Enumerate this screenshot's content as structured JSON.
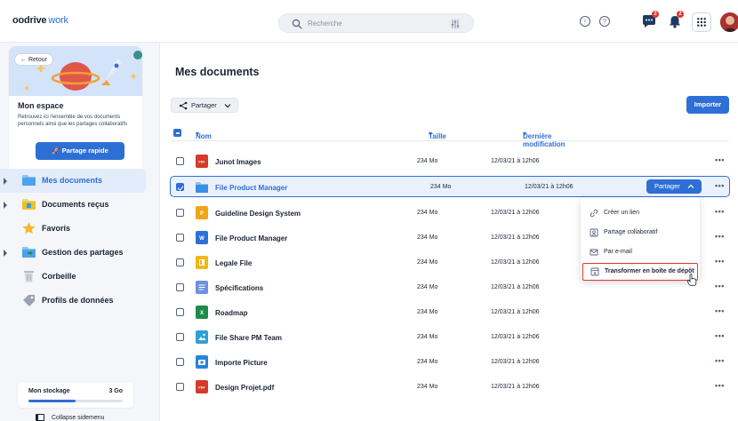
{
  "brand": {
    "name": "oodrive",
    "product": "work"
  },
  "search": {
    "placeholder": "Recherche"
  },
  "topbar": {
    "chat_badge": "2",
    "notif_badge": "2"
  },
  "sidebar": {
    "back_label": "Retour",
    "space_title": "Mon espace",
    "space_desc": "Retrouvez ici l'ensemble de vos documents personnels ainsi que les partages collaboratifs",
    "quick_share_label": "Partage rapide",
    "items": [
      {
        "label": "Mes documents",
        "icon": "folder-icon",
        "active": true
      },
      {
        "label": "Documents reçus",
        "icon": "received-folder-icon"
      },
      {
        "label": "Favoris",
        "icon": "star-icon"
      },
      {
        "label": "Gestion des partages",
        "icon": "share-folder-icon"
      },
      {
        "label": "Corbeille",
        "icon": "trash-icon"
      },
      {
        "label": "Profils de données",
        "icon": "tag-icon"
      }
    ],
    "storage_label": "Mon stockage",
    "storage_value": "3 Go",
    "storage_used_fraction": 0.5,
    "collapse_label": "Collapse sidemenu"
  },
  "main": {
    "title": "Mes documents",
    "share_button": "Partager",
    "import_button": "Importer",
    "columns": {
      "name": "Nom",
      "size": "Taille",
      "modified": "Dernière modification"
    },
    "rows": [
      {
        "name": "Junot Images",
        "size": "234 Mo",
        "date": "12/03/21 à 12h06",
        "icon": "pdf-icon",
        "color": "#d63a2a",
        "badge": "PDF"
      },
      {
        "name": "File Product Manager",
        "size": "234 Mo",
        "date": "12/03/21 à 12h06",
        "icon": "folder-icon",
        "color": "#3a8ee6",
        "selected": true
      },
      {
        "name": "Guideline Design System",
        "size": "234 Mo",
        "date": "12/03/21 à 12h06",
        "icon": "slides-icon",
        "color": "#f2a516"
      },
      {
        "name": "File Product Manager",
        "size": "234 Mo",
        "date": "12/03/21 à 12h06",
        "icon": "word-icon",
        "color": "#2e6fd6"
      },
      {
        "name": "Legale File",
        "size": "234 Mo",
        "date": "12/03/21 à 12h06",
        "icon": "sheet-icon",
        "color": "#f2b716"
      },
      {
        "name": "Spécifications",
        "size": "234 Mo",
        "date": "12/03/21 à 12h06",
        "icon": "doc-icon",
        "color": "#6f8fe0"
      },
      {
        "name": "Roadmap",
        "size": "234 Mo",
        "date": "12/03/21 à 12h06",
        "icon": "excel-icon",
        "color": "#1f8a4c"
      },
      {
        "name": "File Share PM Team",
        "size": "234 Mo",
        "date": "12/03/21 à 12h06",
        "icon": "image-icon",
        "color": "#2fa0d8"
      },
      {
        "name": "Importe Picture",
        "size": "234 Mo",
        "date": "12/03/21 à 12h06",
        "icon": "camera-icon",
        "color": "#2784d6"
      },
      {
        "name": "Design Projet.pdf",
        "size": "234 Mo",
        "date": "12/03/21 à 12h06",
        "icon": "pdf-icon",
        "color": "#d63a2a",
        "badge": "PDF"
      }
    ],
    "row_share_button": "Partager",
    "menu": [
      {
        "label": "Créer un lien",
        "icon": "link-icon"
      },
      {
        "label": "Partage collaboratif",
        "icon": "collab-icon"
      },
      {
        "label": "Par e-mail",
        "icon": "mail-icon"
      },
      {
        "label": "Transformer en boîte de dépôt",
        "icon": "dropbox-icon",
        "highlighted": true
      }
    ]
  }
}
